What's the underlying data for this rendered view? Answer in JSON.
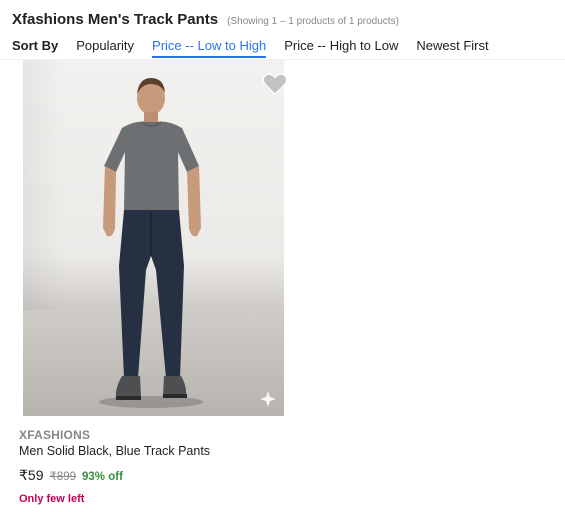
{
  "header": {
    "title": "Xfashions Men's Track Pants",
    "result_count": "(Showing 1 – 1 products of 1 products)"
  },
  "sort": {
    "label": "Sort By",
    "options": [
      "Popularity",
      "Price -- Low to High",
      "Price -- High to Low",
      "Newest First"
    ],
    "active": "Price -- Low to High"
  },
  "product": {
    "brand": "XFASHIONS",
    "title": "Men Solid Black, Blue Track Pants",
    "price": "₹59",
    "mrp": "₹899",
    "discount": "93% off",
    "stock_note": "Only few left",
    "image_icon": "sparkle-icon",
    "wishlist_icon": "heart-icon"
  },
  "colors": {
    "accent": "#2874f0",
    "discount": "#388e3c",
    "stock": "#c70055",
    "muted": "#878787"
  }
}
